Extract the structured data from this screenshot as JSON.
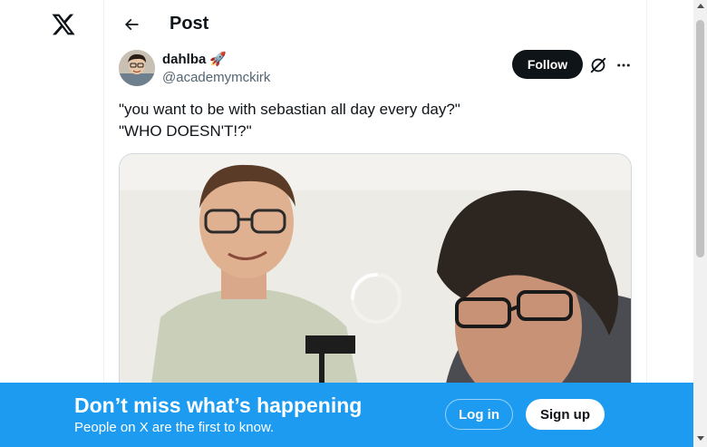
{
  "header": {
    "title": "Post",
    "back_icon": "arrow-left-icon",
    "logo_icon": "x-logo-icon"
  },
  "author": {
    "display_name": "dahlba",
    "name_emoji": "🚀",
    "handle": "@academymckirk",
    "follow_label": "Follow",
    "grok_icon": "grok-icon",
    "more_icon": "more-horizontal-icon"
  },
  "tweet": {
    "line1": "\"you want to be with sebastian all day every day?\"",
    "line2": "\"WHO DOESN'T!?\""
  },
  "media": {
    "loading_icon": "spinner-icon"
  },
  "banner": {
    "headline": "Don’t miss what’s happening",
    "subtext": "People on X are the first to know.",
    "login_label": "Log in",
    "signup_label": "Sign up"
  },
  "colors": {
    "brand": "#1d9bf0",
    "text": "#0f1419",
    "secondary_text": "#536471",
    "follow_bg": "#0f1419"
  }
}
